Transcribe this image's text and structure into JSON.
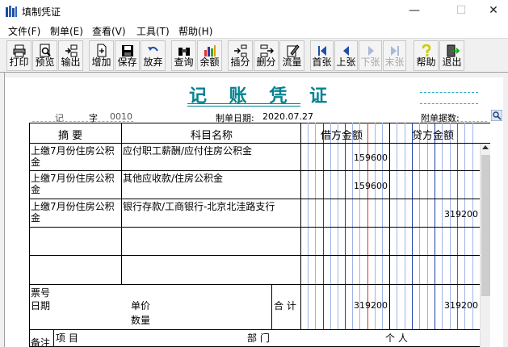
{
  "window": {
    "title": "填制凭证"
  },
  "menu": [
    "文件(F)",
    "制单(E)",
    "查看(V)",
    "工具(T)",
    "帮助(H)"
  ],
  "toolbar": {
    "print": "打印",
    "preview": "预览",
    "export": "输出",
    "add": "增加",
    "save": "保存",
    "discard": "放弃",
    "query": "查询",
    "balance": "余额",
    "insert_row": "插分",
    "delete_row": "删分",
    "flow": "流量",
    "first": "首张",
    "prev": "上张",
    "next": "下张",
    "last": "末张",
    "help": "帮助",
    "exit": "退出"
  },
  "voucher": {
    "title": "记 账 凭 证",
    "type": "记",
    "word_label": "字",
    "number": "0010",
    "date_label": "制单日期:",
    "date": "2020.07.27",
    "attachments_label": "附单据数:",
    "columns": {
      "summary": "摘 要",
      "account": "科目名称",
      "debit": "借方金额",
      "credit": "贷方金额"
    },
    "rows": [
      {
        "summary": "上缴7月份住房公积金",
        "account": "应付职工薪酬/应付住房公积金",
        "debit": "159600",
        "credit": ""
      },
      {
        "summary": "上缴7月份住房公积金",
        "account": "其他应收款/住房公积金",
        "debit": "159600",
        "credit": ""
      },
      {
        "summary": "上缴7月份住房公积金",
        "account": "银行存款/工商银行-北京北洼路支行",
        "debit": "",
        "credit": "319200"
      }
    ],
    "footer": {
      "ticket_no_label": "票号",
      "date_label": "日期",
      "unit_price_label": "单价",
      "quantity_label": "数量",
      "total_label": "合 计",
      "total_debit": "319200",
      "total_credit": "319200"
    },
    "notes": {
      "label": "备注",
      "item_label": "项 目",
      "dept_label": "部 门",
      "person_label": "个 人"
    }
  }
}
